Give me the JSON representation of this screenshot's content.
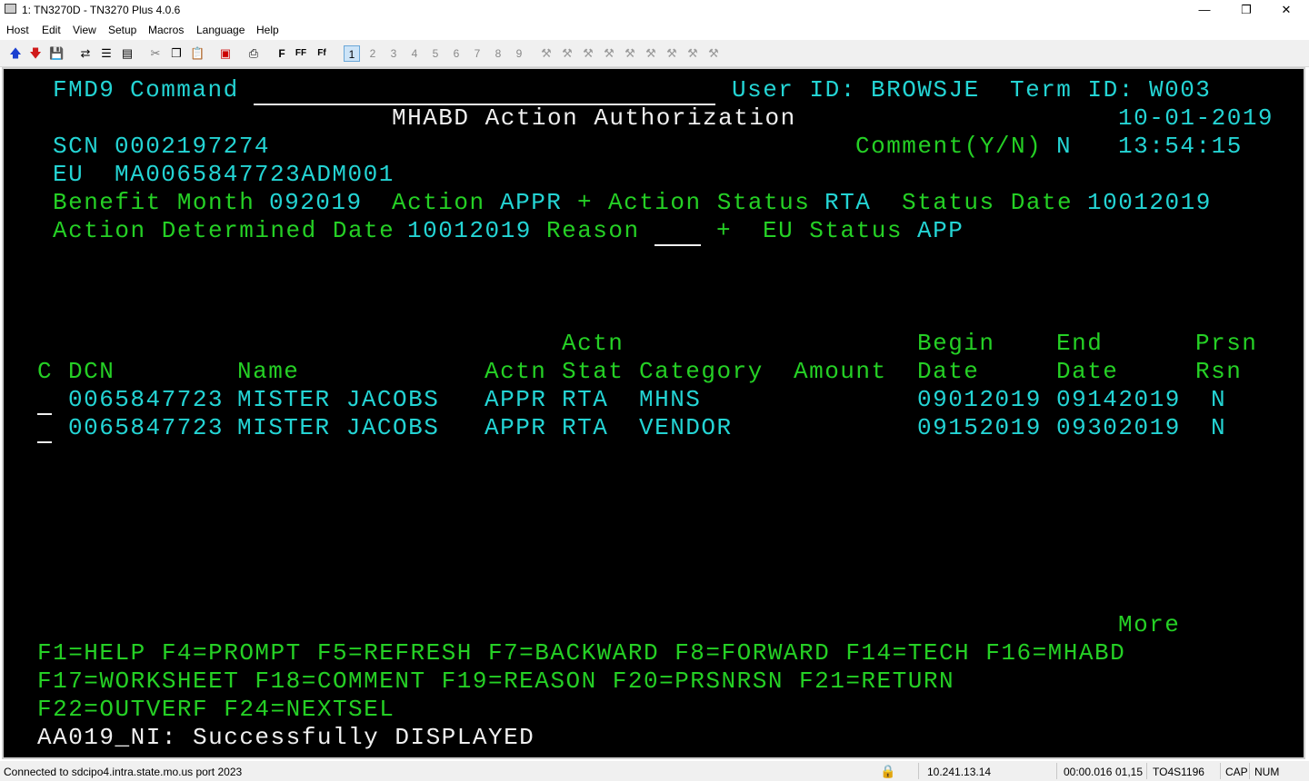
{
  "window": {
    "title": "1: TN3270D - TN3270 Plus 4.0.6",
    "minimize": "—",
    "maximize": "❐",
    "close": "✕"
  },
  "menu": [
    "Host",
    "Edit",
    "View",
    "Setup",
    "Macros",
    "Language",
    "Help"
  ],
  "toolbar": {
    "session_numbers": [
      "1",
      "2",
      "3",
      "4",
      "5",
      "6",
      "7",
      "8",
      "9"
    ],
    "active_session": "1",
    "font_buttons": [
      "F",
      "FF",
      "Ff"
    ],
    "icons": [
      "arrow-up-icon",
      "arrow-down-icon",
      "save-icon",
      "transfer-icon",
      "setup-icon",
      "print-preview-icon",
      "cut-icon",
      "copy-icon",
      "paste-icon",
      "macro-icon",
      "print-icon",
      "font-icon",
      "tool-icon"
    ]
  },
  "screen": {
    "header": {
      "program": "FMD9",
      "command_label": "Command",
      "command_value": "",
      "user_label": "User ID:",
      "user_value": "BROWSJE",
      "term_label": "Term ID:",
      "term_value": "W003",
      "title": "MHABD Action Authorization",
      "date": "10-01-2019",
      "time": "13:54:15",
      "comment_label": "Comment(Y/N)",
      "comment_value": "N"
    },
    "case": {
      "scn_label": "SCN",
      "scn_value": "0002197274",
      "eu_label": "EU",
      "eu_value": "MA0065847723ADM001",
      "benefit_month_label": "Benefit Month",
      "benefit_month_value": "092019",
      "action_label": "Action",
      "action_value": "APPR",
      "action_prompt": "+",
      "action_status_label": "Action Status",
      "action_status_value": "RTA",
      "status_date_label": "Status Date",
      "status_date_value": "10012019",
      "determined_date_label": "Action Determined Date",
      "determined_date_value": "10012019",
      "reason_label": "Reason",
      "reason_value": "",
      "reason_prompt": "+",
      "eu_status_label": "EU Status",
      "eu_status_value": "APP"
    },
    "table": {
      "header_top": {
        "stat": "Actn",
        "begin": "Begin",
        "end": "End",
        "prsn": "Prsn"
      },
      "header": {
        "c": "C",
        "dcn": "DCN",
        "name": "Name",
        "actn": "Actn",
        "stat": "Stat",
        "category": "Category",
        "amount": "Amount",
        "begin": "Date",
        "end": "Date",
        "rsn": "Rsn"
      },
      "rows": [
        {
          "sel": "",
          "dcn": "0065847723",
          "name": "MISTER JACOBS",
          "actn": "APPR",
          "stat": "RTA",
          "category": "MHNS",
          "amount": "",
          "begin": "09012019",
          "end": "09142019",
          "rsn": "N"
        },
        {
          "sel": "",
          "dcn": "0065847723",
          "name": "MISTER JACOBS",
          "actn": "APPR",
          "stat": "RTA",
          "category": "VENDOR",
          "amount": "",
          "begin": "09152019",
          "end": "09302019",
          "rsn": "N"
        }
      ]
    },
    "more": "More",
    "fkeys": [
      "F1=HELP F4=PROMPT F5=REFRESH F7=BACKWARD F8=FORWARD F14=TECH F16=MHABD",
      "F17=WORKSHEET F18=COMMENT F19=REASON F20=PRSNRSN F21=RETURN",
      "F22=OUTVERF F24=NEXTSEL"
    ],
    "message": "AA019_NI: Successfully DISPLAYED"
  },
  "statusbar": {
    "connection": "Connected to sdcipo4.intra.state.mo.us port 2023",
    "ip": "10.241.13.14",
    "elapsed": "00:00.016",
    "cursor": "01,15",
    "lu": "TO4S1196",
    "cap": "CAP",
    "num": "NUM"
  },
  "colors": {
    "terminal_bg": "#000000",
    "cyan": "#24d4d4",
    "green": "#25d025",
    "white": "#f0f0f0"
  }
}
